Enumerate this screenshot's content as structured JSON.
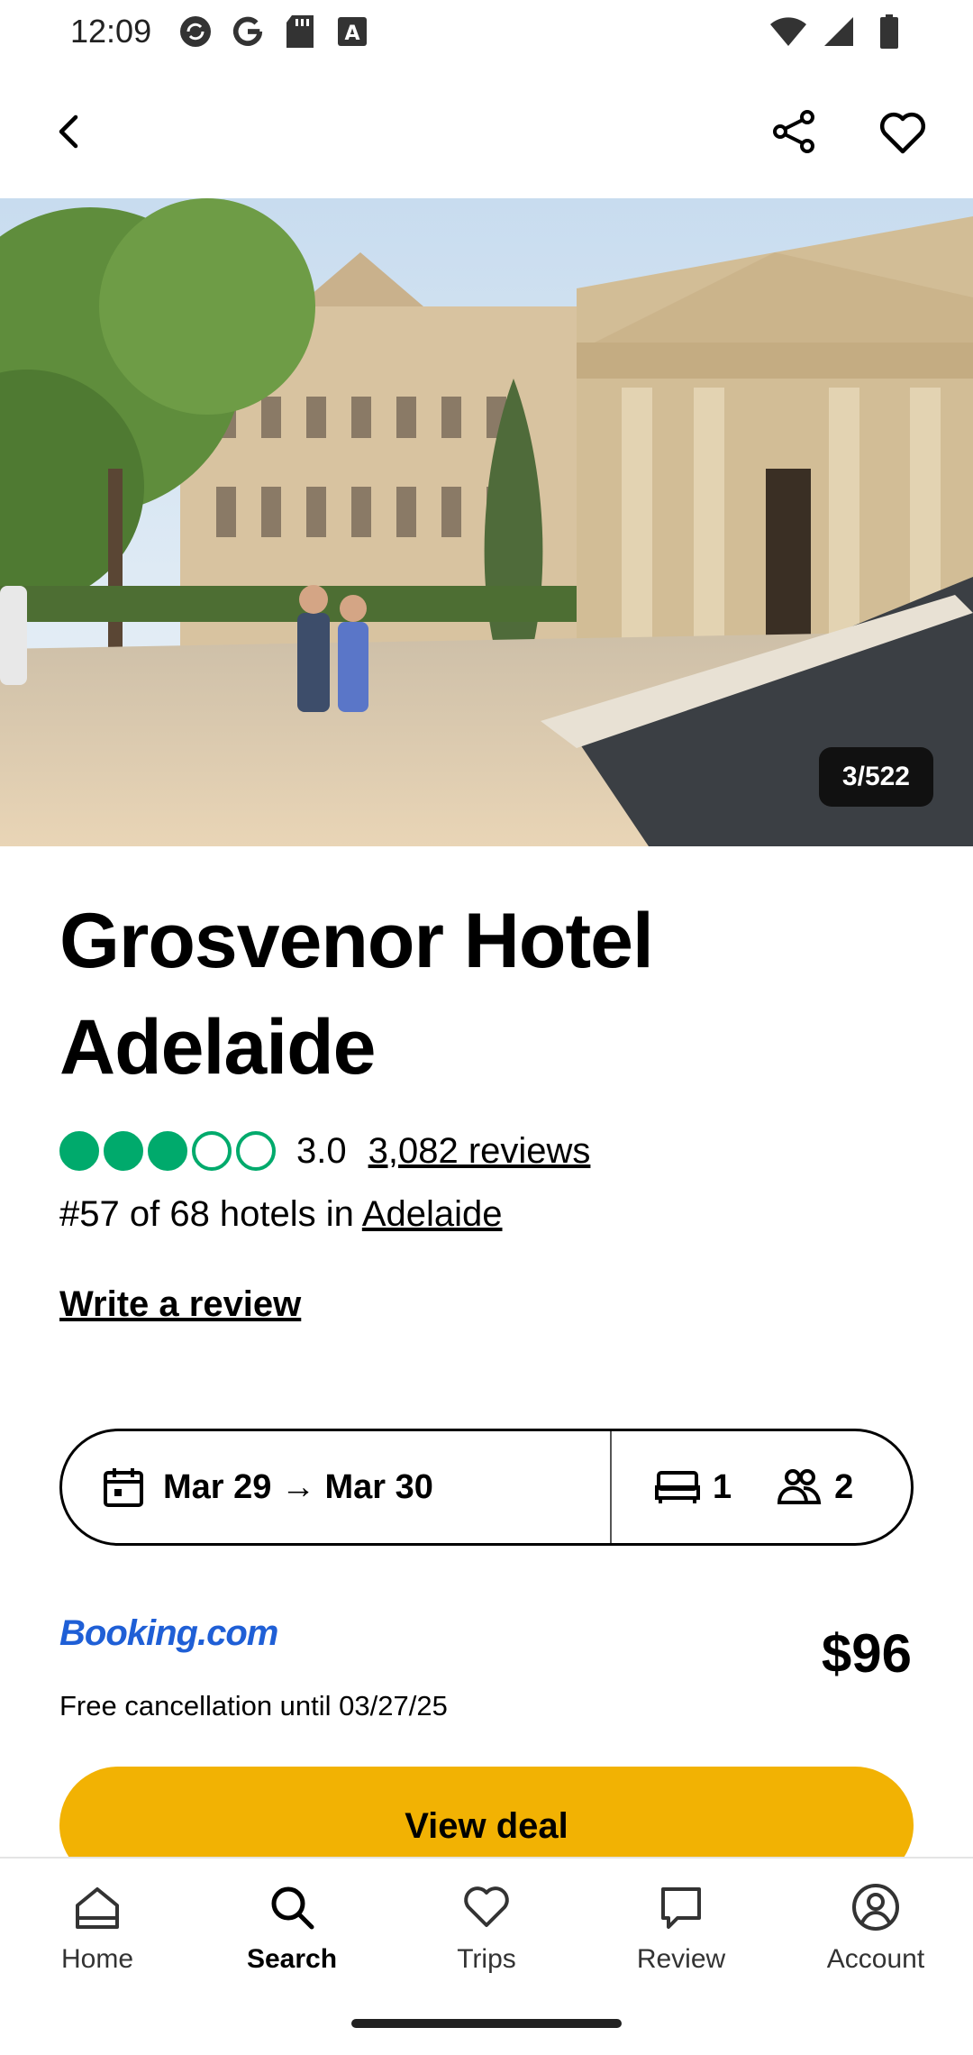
{
  "status": {
    "time": "12:09",
    "left_icons": [
      "sync-icon",
      "google-icon",
      "sd-card-icon",
      "font-icon"
    ],
    "right_icons": [
      "wifi-icon",
      "signal-icon",
      "battery-icon"
    ]
  },
  "header": {
    "back_icon": "back-arrow-icon",
    "share_icon": "share-icon",
    "save_icon": "heart-icon"
  },
  "hero": {
    "counter": "3/522"
  },
  "hotel": {
    "name": "Grosvenor Hotel Adelaide",
    "rating": "3.0",
    "rating_bubbles_filled": 3,
    "rating_bubbles_total": 5,
    "reviews_link": "3,082 reviews",
    "rank_prefix": "#57 of 68 hotels in ",
    "rank_city": "Adelaide",
    "write_review": "Write a review"
  },
  "booking": {
    "dates": "Mar 29 → Mar 30",
    "rooms": "1",
    "guests": "2"
  },
  "offer": {
    "provider": "Booking.com",
    "price": "$96",
    "cancellation": "Free cancellation until 03/27/25",
    "cta": "View deal"
  },
  "nav": {
    "items": [
      {
        "label": "Home",
        "icon": "home-icon"
      },
      {
        "label": "Search",
        "icon": "search-icon"
      },
      {
        "label": "Trips",
        "icon": "heart-icon"
      },
      {
        "label": "Review",
        "icon": "review-icon"
      },
      {
        "label": "Account",
        "icon": "account-icon"
      }
    ],
    "active": "Search"
  },
  "colors": {
    "rating_green": "#00aa6c",
    "cta_yellow": "#f2b203",
    "provider_blue": "#1f5fd6"
  }
}
